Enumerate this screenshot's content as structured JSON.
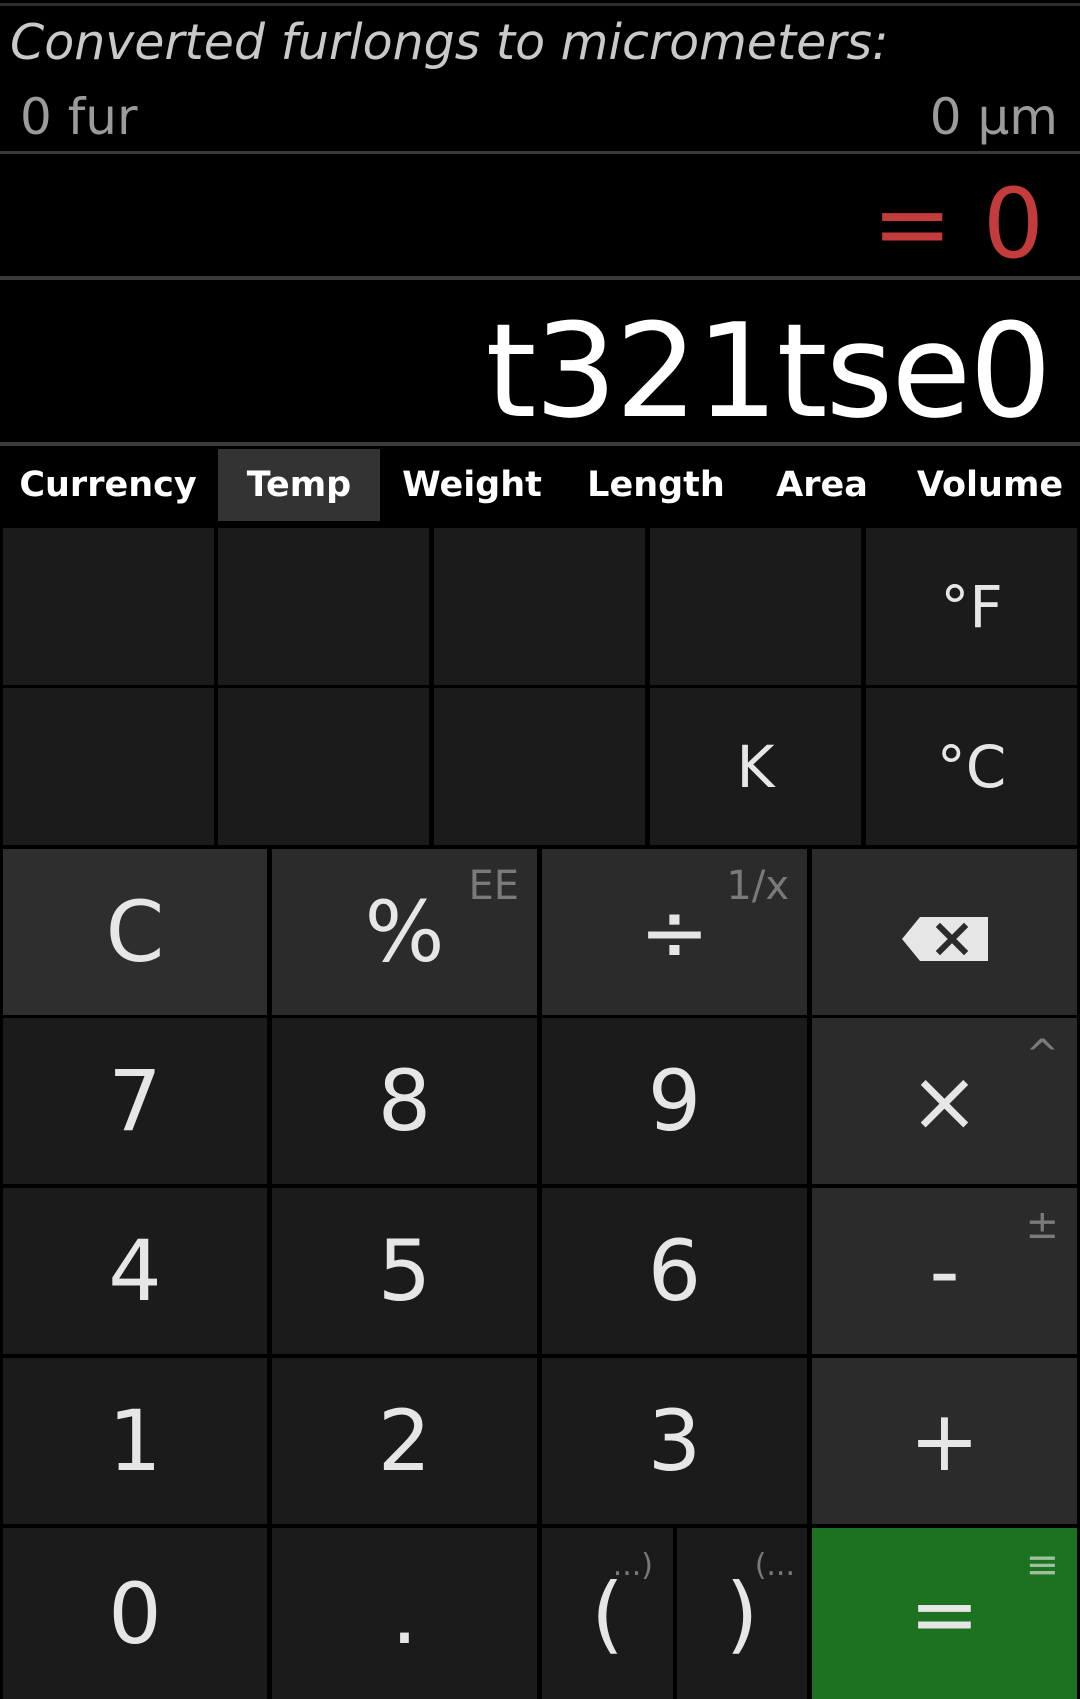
{
  "conversion": {
    "title": "Converted furlongs to micrometers:",
    "from_value": "0 fur",
    "to_value": "0 μm"
  },
  "result": "= 0",
  "expression": "t321tse0",
  "tabs": [
    {
      "label": "Currency",
      "active": false
    },
    {
      "label": "Temp",
      "active": true
    },
    {
      "label": "Weight",
      "active": false
    },
    {
      "label": "Length",
      "active": false
    },
    {
      "label": "Area",
      "active": false
    },
    {
      "label": "Volume",
      "active": false
    }
  ],
  "units": {
    "fahrenheit": "°F",
    "kelvin": "K",
    "celsius": "°C"
  },
  "keys": {
    "clear": "C",
    "percent": "%",
    "percent_sub": "EE",
    "divide": "÷",
    "divide_sub": "1/x",
    "backspace_icon": "backspace-icon",
    "seven": "7",
    "eight": "8",
    "nine": "9",
    "multiply": "×",
    "multiply_sub": "^",
    "four": "4",
    "five": "5",
    "six": "6",
    "minus": "-",
    "minus_sub": "±",
    "one": "1",
    "two": "2",
    "three": "3",
    "plus": "+",
    "zero": "0",
    "dot": ".",
    "open_paren": "(",
    "open_paren_sub": "...)",
    "close_paren": ")",
    "close_paren_sub": "(...",
    "equals": "=",
    "equals_sub": "≡"
  },
  "colors": {
    "result_red": "#c43b3b",
    "equals_green": "#1c7220",
    "key_bg": "#1b1b1b",
    "op_bg": "#2b2b2b"
  }
}
